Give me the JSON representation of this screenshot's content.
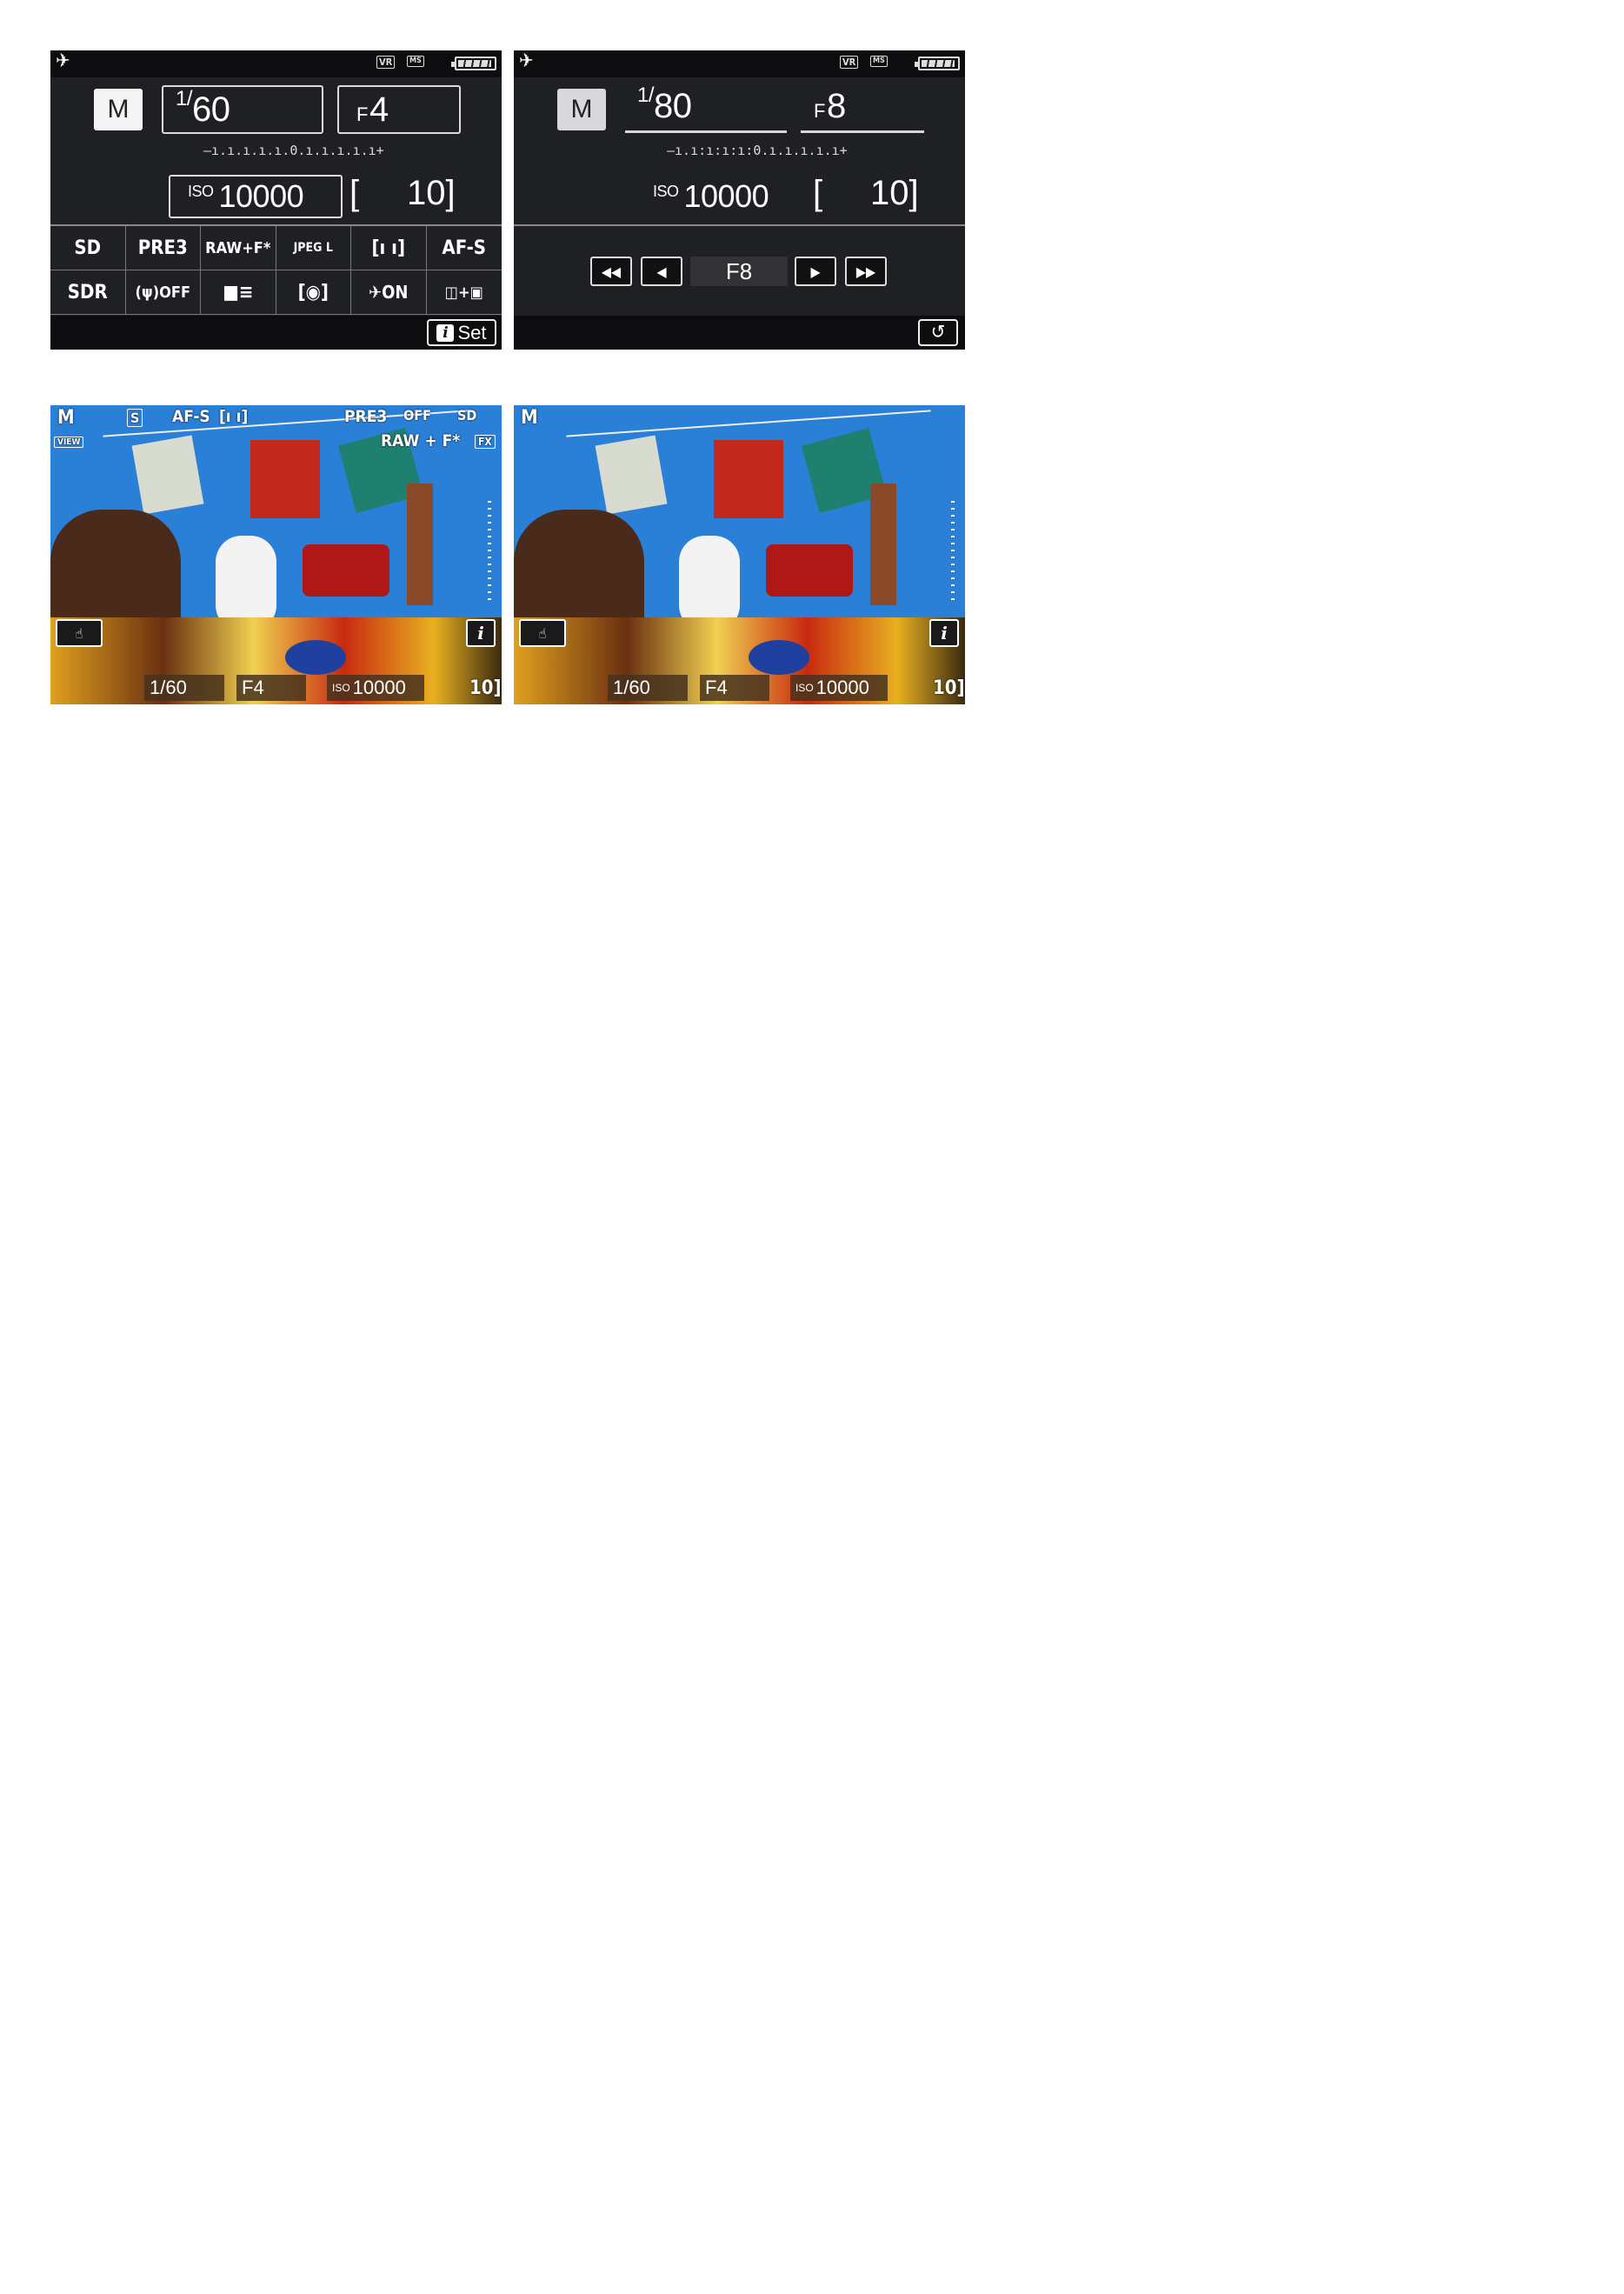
{
  "panel1": {
    "top_icons": {
      "airplane": "airplane-mode-icon",
      "vr_label": "VR",
      "ms_label": "MS"
    },
    "mode": "M",
    "shutter_prefix": "1/",
    "shutter": "60",
    "aperture_prefix": "F",
    "aperture": "4",
    "exposure_scale": "–ı.ı.ı.ı.ı.0.ı.ı.ı.ı.ı+",
    "iso_label": "ISO",
    "iso": "10000",
    "shots_remaining": "10",
    "settings_grid": [
      "SD",
      "PRE3",
      "RAW+F*",
      "JPEG L",
      "[ı ı]",
      "AF-S",
      "SDR",
      "(ψ)OFF",
      "■≡",
      "[◉]",
      "✈ON",
      "◫+▣"
    ],
    "set_label": "Set"
  },
  "panel2": {
    "mode": "M",
    "shutter_prefix": "1/",
    "shutter": "80",
    "aperture_prefix": "F",
    "aperture": "8",
    "exposure_scale": "–ı.ı:ı:ı:ı:0.ı.ı.ı.ı.ı+",
    "iso_label": "ISO",
    "iso": "10000",
    "shots_remaining": "10",
    "nav": {
      "fast_back": "◀◀",
      "back": "◀",
      "value": "F8",
      "forward": "▶",
      "fast_forward": "▶▶"
    },
    "back_label": "↺"
  },
  "panel3": {
    "top_left": {
      "mode": "M",
      "shutter_priority_box": "S",
      "af_mode": "AF-S",
      "area": "[ı ı]"
    },
    "top_right": {
      "pre": "PRE3",
      "off": "OFF",
      "sd": "SD"
    },
    "second_row": {
      "view": "VIEW",
      "quality": "RAW + F*",
      "fx": "FX"
    },
    "shutter": "1/60",
    "aperture": "F4",
    "iso_label": "ISO",
    "iso": "10000",
    "shots": "10",
    "i_label": "i"
  },
  "panel4": {
    "mode": "M",
    "shutter": "1/60",
    "aperture": "F4",
    "iso_label": "ISO",
    "iso": "10000",
    "shots": "10",
    "i_label": "i"
  }
}
